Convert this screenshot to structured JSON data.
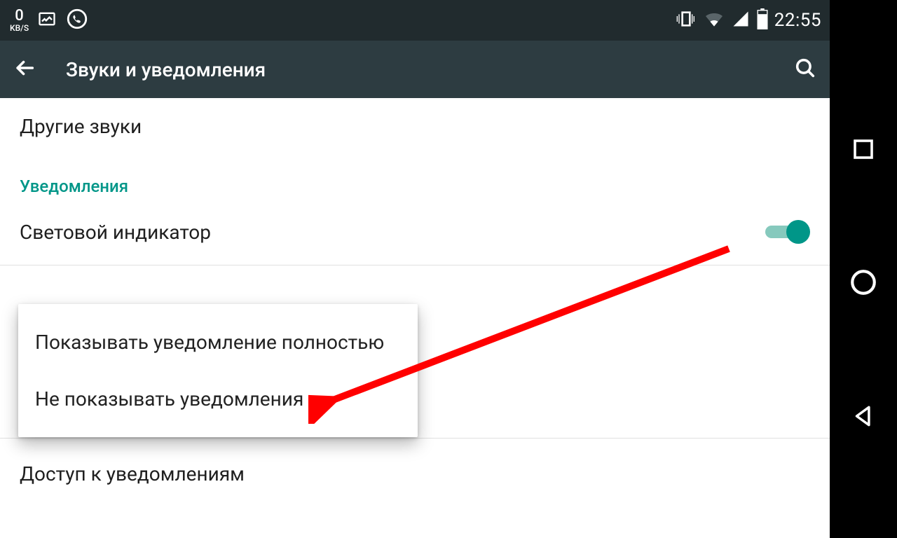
{
  "status": {
    "speed_value": "0",
    "speed_unit": "KB/S",
    "time": "22:55"
  },
  "appbar": {
    "title": "Звуки и уведомления"
  },
  "content": {
    "other_sounds": "Другие звуки",
    "section_notifications": "Уведомления",
    "led_indicator": "Световой индикатор",
    "access_notifications": "Доступ к уведомлениям"
  },
  "popup": {
    "item1": "Показывать уведомление полностью",
    "item2": "Не показывать уведомления"
  }
}
